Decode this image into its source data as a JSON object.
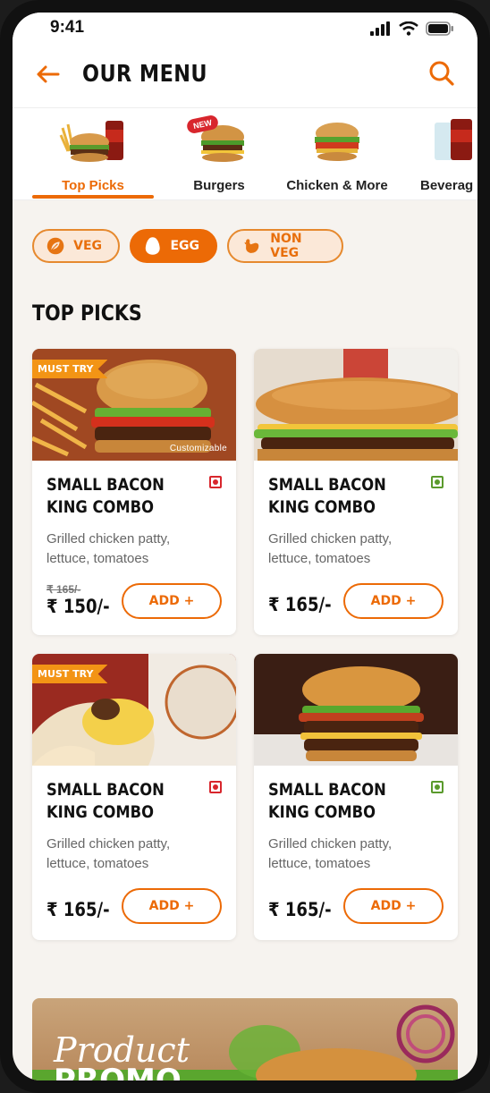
{
  "status_bar": {
    "time": "9:41"
  },
  "header": {
    "title": "OUR MENU",
    "back_icon": "arrow-left-icon",
    "search_icon": "search-icon"
  },
  "categories": [
    {
      "label": "Top Picks",
      "active": true
    },
    {
      "label": "Burgers",
      "badge": "NEW"
    },
    {
      "label": "Chicken & More"
    },
    {
      "label": "Beverag"
    }
  ],
  "filters": [
    {
      "label": "VEG",
      "active": false
    },
    {
      "label": "EGG",
      "active": true
    },
    {
      "label": "NON VEG",
      "active": false
    }
  ],
  "section_title": "TOP PICKS",
  "products": [
    {
      "name_line1": "SMALL BACON",
      "name_line2": "KING COMBO",
      "desc_line1": "Grilled chicken patty,",
      "desc_line2": "lettuce, tomatoes",
      "old_price": "₹ 165/-",
      "price": "₹ 150/-",
      "badge": "MUST TRY",
      "note": "Customizable",
      "diet": "non-veg",
      "add_label": "ADD +"
    },
    {
      "name_line1": "SMALL BACON",
      "name_line2": "KING COMBO",
      "desc_line1": "Grilled chicken patty,",
      "desc_line2": "lettuce, tomatoes",
      "price": "₹ 165/-",
      "diet": "veg",
      "add_label": "ADD +"
    },
    {
      "name_line1": "SMALL BACON",
      "name_line2": "KING COMBO",
      "desc_line1": "Grilled chicken patty,",
      "desc_line2": "lettuce, tomatoes",
      "price": "₹ 165/-",
      "badge": "MUST TRY",
      "diet": "non-veg",
      "add_label": "ADD +"
    },
    {
      "name_line1": "SMALL BACON",
      "name_line2": "KING COMBO",
      "desc_line1": "Grilled chicken patty,",
      "desc_line2": "lettuce, tomatoes",
      "price": "₹ 165/-",
      "diet": "veg",
      "add_label": "ADD +"
    }
  ],
  "promo": {
    "line1": "Product",
    "line2": "PROMO"
  },
  "colors": {
    "accent": "#ec6a06",
    "veg": "#5a9a2c",
    "non_veg": "#d8262d"
  }
}
